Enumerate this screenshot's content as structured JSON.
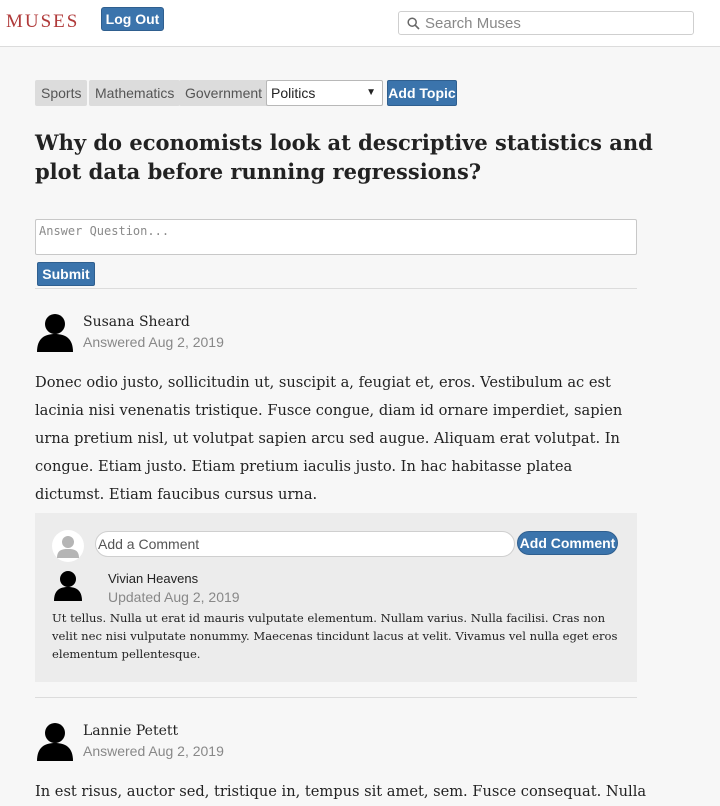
{
  "header": {
    "logo": "MUSES",
    "logout_label": "Log Out",
    "search_placeholder": "Search Muses",
    "search_value": ""
  },
  "topics": {
    "tags": [
      "Sports",
      "Mathematics",
      "Government"
    ],
    "select_value": "Politics",
    "add_label": "Add Topic"
  },
  "question": {
    "title": "Why do economists look at descriptive statistics and plot data before running regressions?"
  },
  "answer_form": {
    "placeholder": "Answer Question...",
    "submit_label": "Submit"
  },
  "answers": [
    {
      "author": "Susana Sheard",
      "date": "Answered Aug 2, 2019",
      "body": "Donec odio justo, sollicitudin ut, suscipit a, feugiat et, eros. Vestibulum ac est lacinia nisi venenatis tristique. Fusce congue, diam id ornare imperdiet, sapien urna pretium nisl, ut volutpat sapien arcu sed augue. Aliquam erat volutpat. In congue. Etiam justo. Etiam pretium iaculis justo. In hac habitasse platea dictumst. Etiam faucibus cursus urna.",
      "comment_form": {
        "placeholder": "Add a Comment",
        "button_label": "Add Comment"
      },
      "comments": [
        {
          "author": "Vivian Heavens",
          "date": "Updated Aug 2, 2019",
          "text": "Ut tellus. Nulla ut erat id mauris vulputate elementum. Nullam varius. Nulla facilisi. Cras non velit nec nisi vulputate nonummy. Maecenas tincidunt lacus at velit. Vivamus vel nulla eget eros elementum pellentesque."
        }
      ]
    },
    {
      "author": "Lannie Petett",
      "date": "Answered Aug 2, 2019",
      "body": "In est risus, auctor sed, tristique in, tempus sit amet, sem. Fusce consequat. Nulla"
    }
  ],
  "icons": {
    "search": "search-icon",
    "avatar": "user-avatar-icon",
    "avatar_placeholder": "default-avatar-icon",
    "select_arrow": "caret-down-icon"
  },
  "colors": {
    "accent": "#3b74ac",
    "logo": "#b03a3a",
    "muted_text": "#888888"
  }
}
